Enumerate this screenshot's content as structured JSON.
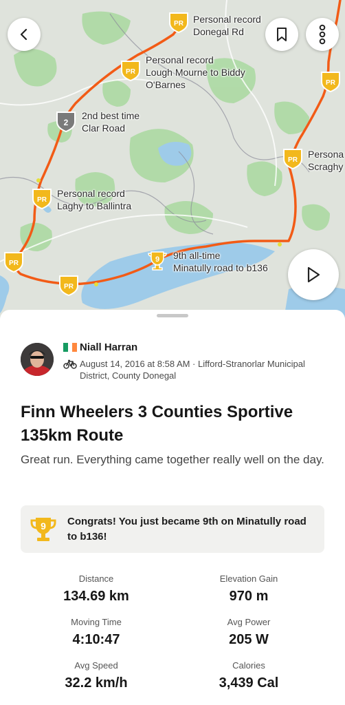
{
  "map": {
    "segments": [
      {
        "badge": "PR",
        "line1": "Personal record",
        "line2": "Donegal Rd",
        "line3": ""
      },
      {
        "badge": "PR",
        "line1": "Personal record",
        "line2": "Lough Mourne to Biddy",
        "line3": "O'Barnes"
      },
      {
        "badge": "2",
        "line1": "2nd best time",
        "line2": "Clar Road",
        "line3": ""
      },
      {
        "badge": "PR",
        "line1": "Persona",
        "line2": "Scraghy",
        "line3": ""
      },
      {
        "badge": "PR",
        "line1": "Personal record",
        "line2": "Laghy to Ballintra",
        "line3": ""
      },
      {
        "badge": "9",
        "line1": "9th all-time",
        "line2": "Minatully road to b136",
        "line3": ""
      },
      {
        "badge": "PR",
        "line1": "",
        "line2": "",
        "line3": ""
      },
      {
        "badge": "PR",
        "line1": "",
        "line2": "",
        "line3": ""
      },
      {
        "badge": "PR",
        "line1": "",
        "line2": "",
        "line3": ""
      }
    ],
    "colors": {
      "route": "#f25b16",
      "land": "#dfe3dc",
      "forest": "#a9d9a0",
      "water": "#9ecbe9",
      "pr_badge": "#f2b81c",
      "silver_badge": "#7a7a7a"
    }
  },
  "controls": {
    "back_icon": "chevron-left-icon",
    "save_icon": "bookmark-icon",
    "more_icon": "more-vertical-icon",
    "play_icon": "play-icon"
  },
  "athlete": {
    "flag": "Ireland",
    "name": "Niall Harran",
    "activity_icon": "bike-icon",
    "meta": "August 14, 2016 at 8:58 AM · Lifford-Stranorlar Municipal District, County Donegal"
  },
  "activity": {
    "title": "Finn Wheelers 3 Counties Sportive 135km Route",
    "description": "Great run. Everything came together really well on the day."
  },
  "achievement": {
    "badge": "9",
    "text": "Congrats! You just became 9th on Minatully road to b136!"
  },
  "stats": [
    {
      "label": "Distance",
      "value": "134.69 km"
    },
    {
      "label": "Elevation Gain",
      "value": "970 m"
    },
    {
      "label": "Moving Time",
      "value": "4:10:47"
    },
    {
      "label": "Avg Power",
      "value": "205 W"
    },
    {
      "label": "Avg Speed",
      "value": "32.2 km/h"
    },
    {
      "label": "Calories",
      "value": "3,439 Cal"
    }
  ]
}
